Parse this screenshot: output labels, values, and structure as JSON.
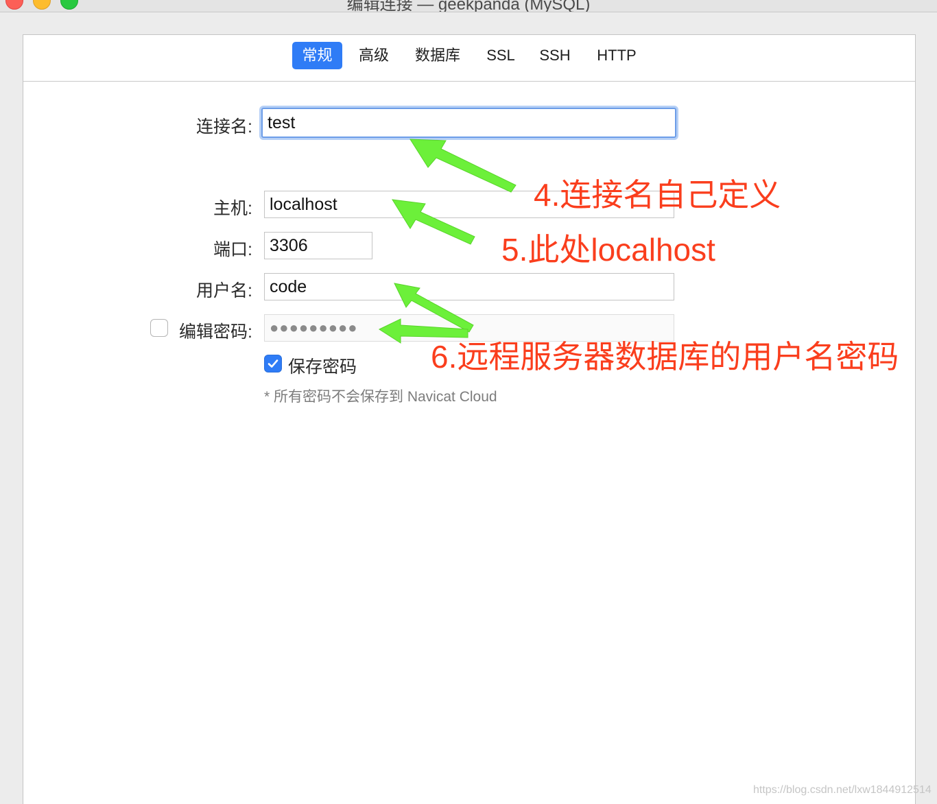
{
  "window": {
    "title": "编辑连接 — geekpanda (MySQL)"
  },
  "tabs": [
    {
      "label": "常规",
      "active": true
    },
    {
      "label": "高级"
    },
    {
      "label": "数据库"
    },
    {
      "label": "SSL"
    },
    {
      "label": "SSH"
    },
    {
      "label": "HTTP"
    }
  ],
  "form": {
    "connection_name": {
      "label": "连接名:",
      "value": "test"
    },
    "host": {
      "label": "主机:",
      "value": "localhost"
    },
    "port": {
      "label": "端口:",
      "value": "3306"
    },
    "username": {
      "label": "用户名:",
      "value": "code"
    },
    "edit_password": {
      "label": "编辑密码:",
      "checked": false,
      "value": "●●●●●●●●●"
    },
    "save_password": {
      "label": "保存密码",
      "checked": true
    },
    "note": "* 所有密码不会保存到 Navicat Cloud"
  },
  "annotations": [
    {
      "text": "4.连接名自己定义"
    },
    {
      "text": "5.此处localhost"
    },
    {
      "text": "6.远程服务器数据库的用户名密码"
    }
  ],
  "watermark": "https://blog.csdn.net/lxw1844912514",
  "colors": {
    "accent": "#2f7cf6",
    "annotation_text": "#fa3e1d",
    "annotation_arrow": "#6cf03a"
  }
}
